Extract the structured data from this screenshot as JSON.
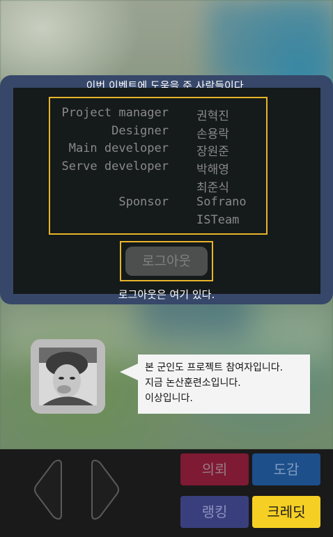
{
  "panel": {
    "title": "이번 이벤트에 도움을 준 사람들이다.",
    "credits": [
      {
        "role": "Project manager",
        "name": "권혁진"
      },
      {
        "role": "Designer",
        "name": "손용락"
      },
      {
        "role": "Main developer",
        "name": "장원준"
      },
      {
        "role": "Serve developer",
        "name": "박해영"
      },
      {
        "role": "",
        "name": "최준식"
      },
      {
        "role": "Sponsor",
        "name": "Sofrano"
      },
      {
        "role": "",
        "name": "ISTeam"
      }
    ],
    "logout_label": "로그아웃",
    "logout_caption": "로그아웃은 여기 있다."
  },
  "dialog": {
    "lines": [
      "본 군인도 프로젝트 참여자입니다.",
      "지금 논산훈련소입니다.",
      "이상입니다."
    ]
  },
  "menu": {
    "quest_label": "의뢰",
    "quest_color": "#7e1a33",
    "dex_label": "도감",
    "dex_color": "#1d4f8a",
    "ranking_label": "랭킹",
    "ranking_color": "#393f7d",
    "credit_label": "크레딧",
    "credit_color": "#f5cf24"
  },
  "colors": {
    "panel_border": "#36476a",
    "highlight": "#e8b52a"
  },
  "icons": {
    "left": "left-arrow-icon",
    "right": "right-arrow-icon"
  }
}
